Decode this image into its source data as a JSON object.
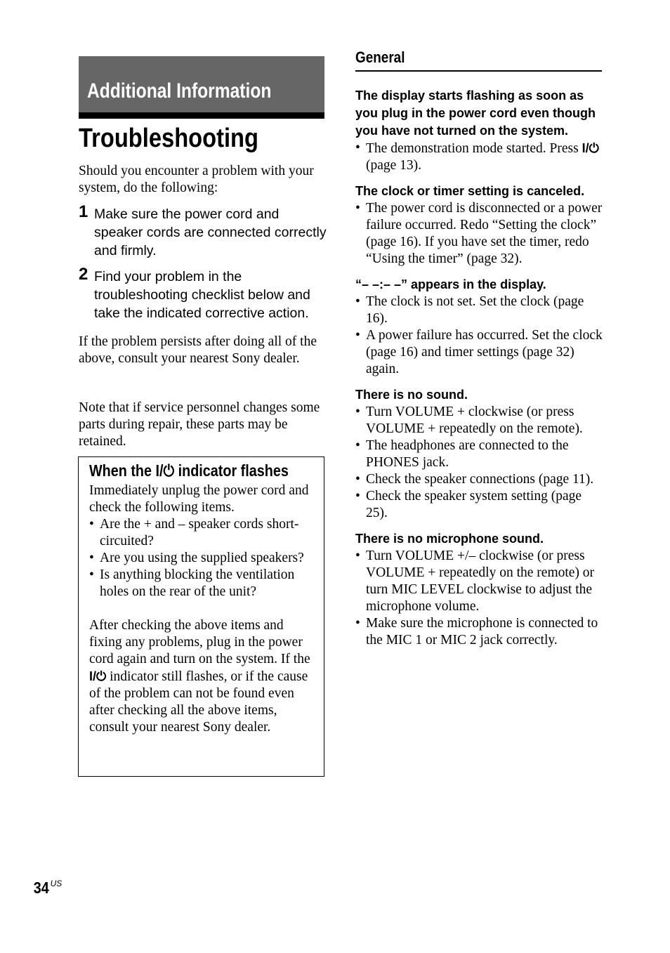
{
  "section_banner": "Additional Information",
  "page_title": "Troubleshooting",
  "intro": "Should you encounter a problem with your system, do the following:",
  "steps": [
    {
      "num": "1",
      "text": "Make sure the power cord and speaker cords are connected correctly and firmly."
    },
    {
      "num": "2",
      "text": "Find your problem in the troubleshooting checklist below and take the indicated corrective action."
    }
  ],
  "persist_text": "If the problem persists after doing all of the above, consult your nearest Sony dealer.",
  "note_text": "Note that if service personnel changes some parts during repair, these parts may be retained.",
  "power_symbol": "I/⏻",
  "flash_box": {
    "title_before": "When the",
    "title_after": "indicator flashes",
    "intro": "Immediately unplug the power cord and check the following items.",
    "items": [
      "Are the + and – speaker cords short-circuited?",
      "Are you using the supplied speakers?",
      "Is anything blocking the ventilation holes on the rear of the unit?"
    ],
    "after_before": "After checking the above items and fixing any problems, plug in the power cord again and turn on the system. If the",
    "after_after": "indicator still flashes, or if the cause of the problem can not be found even after checking all the above items, consult your nearest Sony dealer."
  },
  "general": {
    "heading": "General",
    "sections": [
      {
        "question": "The display starts flashing as soon as you plug in the power cord even though you have not turned on the system.",
        "answers": [
          "The demonstration mode started. Press"
        ],
        "answer_suffix": "(page 13)."
      },
      {
        "question": "The clock or timer setting is canceled.",
        "answers": [
          "The power cord is disconnected or a power failure occurred. Redo “Setting the clock” (page 16). If you have set the timer, redo “Using the timer” (page 32)."
        ]
      },
      {
        "question": "“– –:– –” appears in the display.",
        "answers": [
          "The clock is not set. Set the clock (page 16).",
          "A power failure has occurred. Set the clock (page 16) and timer settings (page 32) again."
        ]
      },
      {
        "question": "There is no sound.",
        "answers": [
          "Turn VOLUME + clockwise (or press VOLUME + repeatedly on the remote).",
          "The headphones are connected to the PHONES jack.",
          "Check the speaker connections (page 11).",
          "Check the speaker system setting (page 25)."
        ]
      },
      {
        "question": "There is no microphone sound.",
        "answers": [
          "Turn VOLUME +/– clockwise (or press VOLUME + repeatedly on the remote) or turn MIC LEVEL clockwise to adjust the microphone volume.",
          "Make sure the microphone is connected to the MIC 1 or MIC 2 jack correctly."
        ]
      }
    ]
  },
  "page_number": "34",
  "page_suffix": "US"
}
